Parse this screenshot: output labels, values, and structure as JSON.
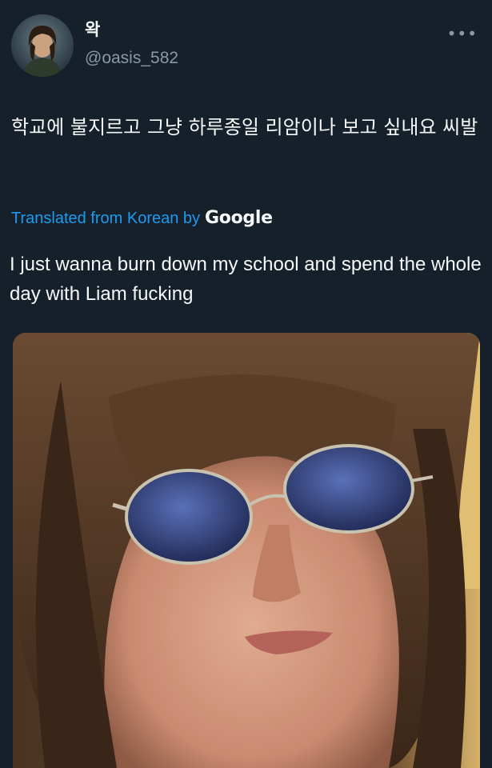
{
  "user": {
    "display_name": "왁",
    "handle": "@oasis_582",
    "avatar_icon": "profile-photo-icon"
  },
  "menu": {
    "more_label": "•••"
  },
  "tweet": {
    "original_text": "학교에 불지르고 그냥 하루종일 리암이나 보고 싶내요 씨발",
    "translated_label": "Translated from Korean by",
    "translator_brand": "Google",
    "translated_text": "I just wanna burn down my school and spend the whole day with Liam fucking"
  },
  "colors": {
    "background": "#15202b",
    "text": "#f7f9f9",
    "secondary": "#8b98a5",
    "accent": "#1d9bf0"
  },
  "media": {
    "icon": "photo-icon"
  }
}
